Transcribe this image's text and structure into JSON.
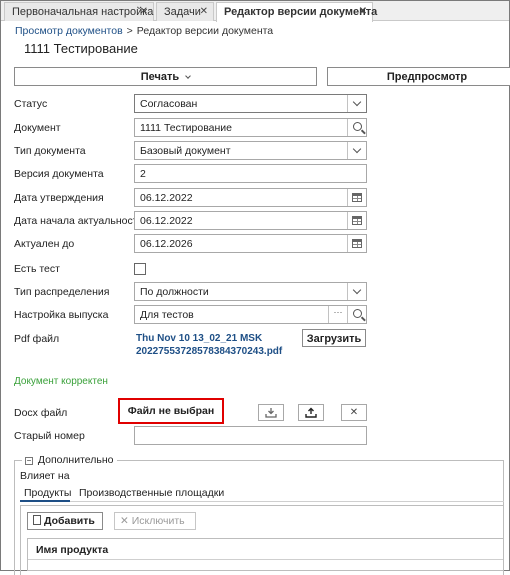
{
  "tabs": [
    {
      "label": "Первоначальная настройка",
      "close": "✕"
    },
    {
      "label": "Задачи",
      "close": "✕"
    },
    {
      "label": "Редактор версии документа",
      "close": "✕"
    }
  ],
  "breadcrumb": {
    "link": "Просмотр документов",
    "separator": ">",
    "current": "Редактор версии документа"
  },
  "page_title": "1111 Тестирование",
  "toolbar": {
    "print_label": "Печать",
    "preview_label": "Предпросмотр"
  },
  "form": {
    "status": {
      "label": "Статус",
      "value": "Согласован"
    },
    "document": {
      "label": "Документ",
      "value": "1111 Тестирование"
    },
    "doc_type": {
      "label": "Тип документа",
      "value": "Базовый документ"
    },
    "version": {
      "label": "Версия документа",
      "value": "2"
    },
    "approval_date": {
      "label": "Дата утверждения",
      "value": "06.12.2022"
    },
    "actual_start": {
      "label": "Дата начала актуальности",
      "value": "06.12.2022"
    },
    "actual_until": {
      "label": "Актуален до",
      "value": "06.12.2026"
    },
    "has_test": {
      "label": "Есть тест",
      "checked": false
    },
    "distribution": {
      "label": "Тип распределения",
      "value": "По должности"
    },
    "release": {
      "label": "Настройка выпуска",
      "value": "Для тестов",
      "dots": "···"
    },
    "pdf": {
      "label": "Pdf файл",
      "line1": "Thu Nov 10 13_02_21 MSK",
      "line2": "20227553728578384370243.pdf",
      "upload_label": "Загрузить"
    },
    "ok_message": "Документ корректен",
    "docx": {
      "label": "Docx файл",
      "file_label": "Файл не выбран",
      "delete_glyph": "✕"
    },
    "old_number": {
      "label": "Старый номер",
      "value": ""
    }
  },
  "additional": {
    "toggle": "−",
    "legend": "Дополнительно",
    "influences_label": "Влияет на",
    "subtabs": [
      "Продукты",
      "Производственные площадки"
    ],
    "add_label": "Добавить",
    "exclude_label": "Исключить",
    "exclude_glyph": "✕",
    "column_header": "Имя продукта"
  },
  "colors": {
    "accent_link": "#1e4f86",
    "ok_green": "#3aa13a",
    "highlight_red": "#e00000"
  }
}
